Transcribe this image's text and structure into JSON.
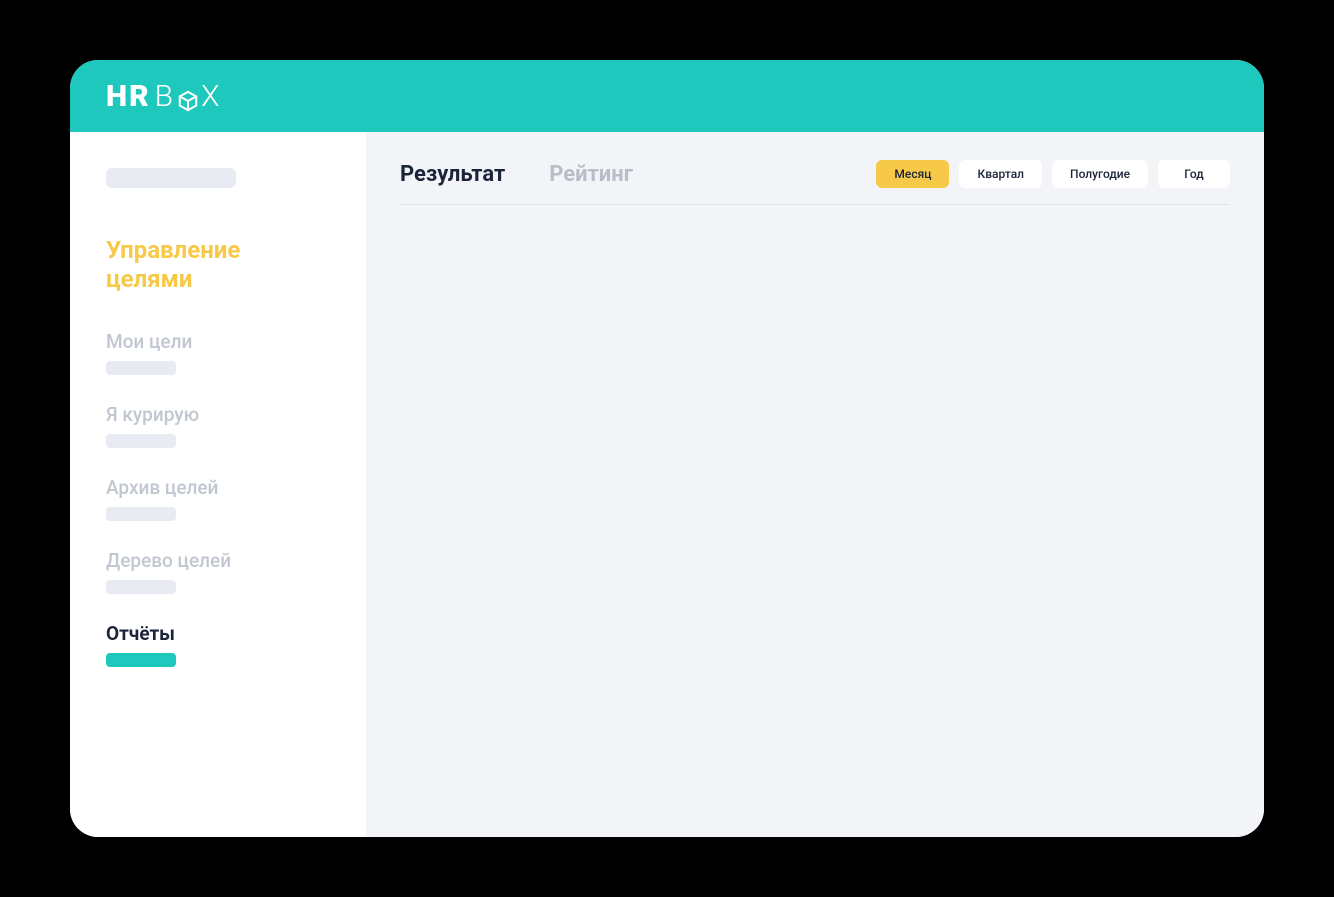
{
  "logo": {
    "hr": "HR",
    "b": "B",
    "x": "X"
  },
  "sidebar": {
    "section_title": "Управление целями",
    "items": [
      {
        "label": "Мои цели",
        "active": false
      },
      {
        "label": "Я курирую",
        "active": false
      },
      {
        "label": "Архив целей",
        "active": false
      },
      {
        "label": "Дерево целей",
        "active": false
      },
      {
        "label": "Отчёты",
        "active": true
      }
    ]
  },
  "main": {
    "tabs": [
      {
        "label": "Результат",
        "active": true
      },
      {
        "label": "Рейтинг",
        "active": false
      }
    ],
    "periods": [
      {
        "label": "Месяц",
        "active": true
      },
      {
        "label": "Квартал",
        "active": false
      },
      {
        "label": "Полугодие",
        "active": false
      },
      {
        "label": "Год",
        "active": false
      }
    ]
  }
}
